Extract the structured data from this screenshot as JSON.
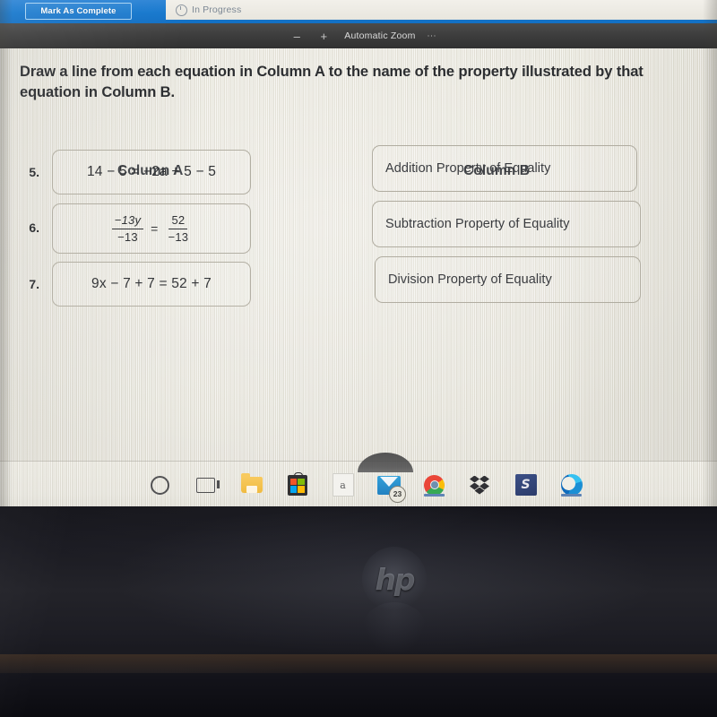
{
  "browser": {
    "mark_complete_label": "Mark As Complete",
    "progress_tab_label": "In Progress",
    "progress_icon": "clock-icon",
    "blue_bar_color": "#1778cd"
  },
  "pdf_toolbar": {
    "zoom_out_label": "–",
    "zoom_in_label": "+",
    "zoom_level_label": "Automatic Zoom",
    "kebab_label": "⋮"
  },
  "worksheet": {
    "instruction": "Draw a line from each equation in Column A to the name of the property illustrated by that equation in Column B.",
    "column_a_header": "Column A",
    "column_b_header": "Column B",
    "column_a_items": [
      {
        "number": "5.",
        "equation": "14 − 5 = −2a + 5 − 5",
        "type": "inline"
      },
      {
        "number": "6.",
        "equation": "−13y/−13 = 52/−13",
        "type": "fraction",
        "left_numerator": "−13y",
        "left_denominator": "−13",
        "equals": "=",
        "right_numerator": "52",
        "right_denominator": "−13"
      },
      {
        "number": "7.",
        "equation": "9x − 7 + 7 = 52 + 7",
        "type": "inline"
      }
    ],
    "column_b_items": [
      {
        "label": "Addition Property of Equality"
      },
      {
        "label": "Subtraction Property of Equality"
      },
      {
        "label": "Division Property of Equality"
      }
    ]
  },
  "taskbar": {
    "icons": [
      {
        "name": "cortana-icon",
        "label": "Cortana"
      },
      {
        "name": "task-view-icon",
        "label": "Task View"
      },
      {
        "name": "file-explorer-icon",
        "label": "File Explorer"
      },
      {
        "name": "microsoft-store-icon",
        "label": "Microsoft Store"
      },
      {
        "name": "adobe-acrobat-icon",
        "label": "a"
      },
      {
        "name": "mail-icon",
        "label": "Mail",
        "badge": "23"
      },
      {
        "name": "google-chrome-icon",
        "label": "Google Chrome"
      },
      {
        "name": "dropbox-icon",
        "label": "Dropbox"
      },
      {
        "name": "blue-app-icon",
        "label": "S"
      },
      {
        "name": "microsoft-edge-icon",
        "label": "Microsoft Edge"
      }
    ]
  },
  "device": {
    "brand_logo": "hp"
  }
}
